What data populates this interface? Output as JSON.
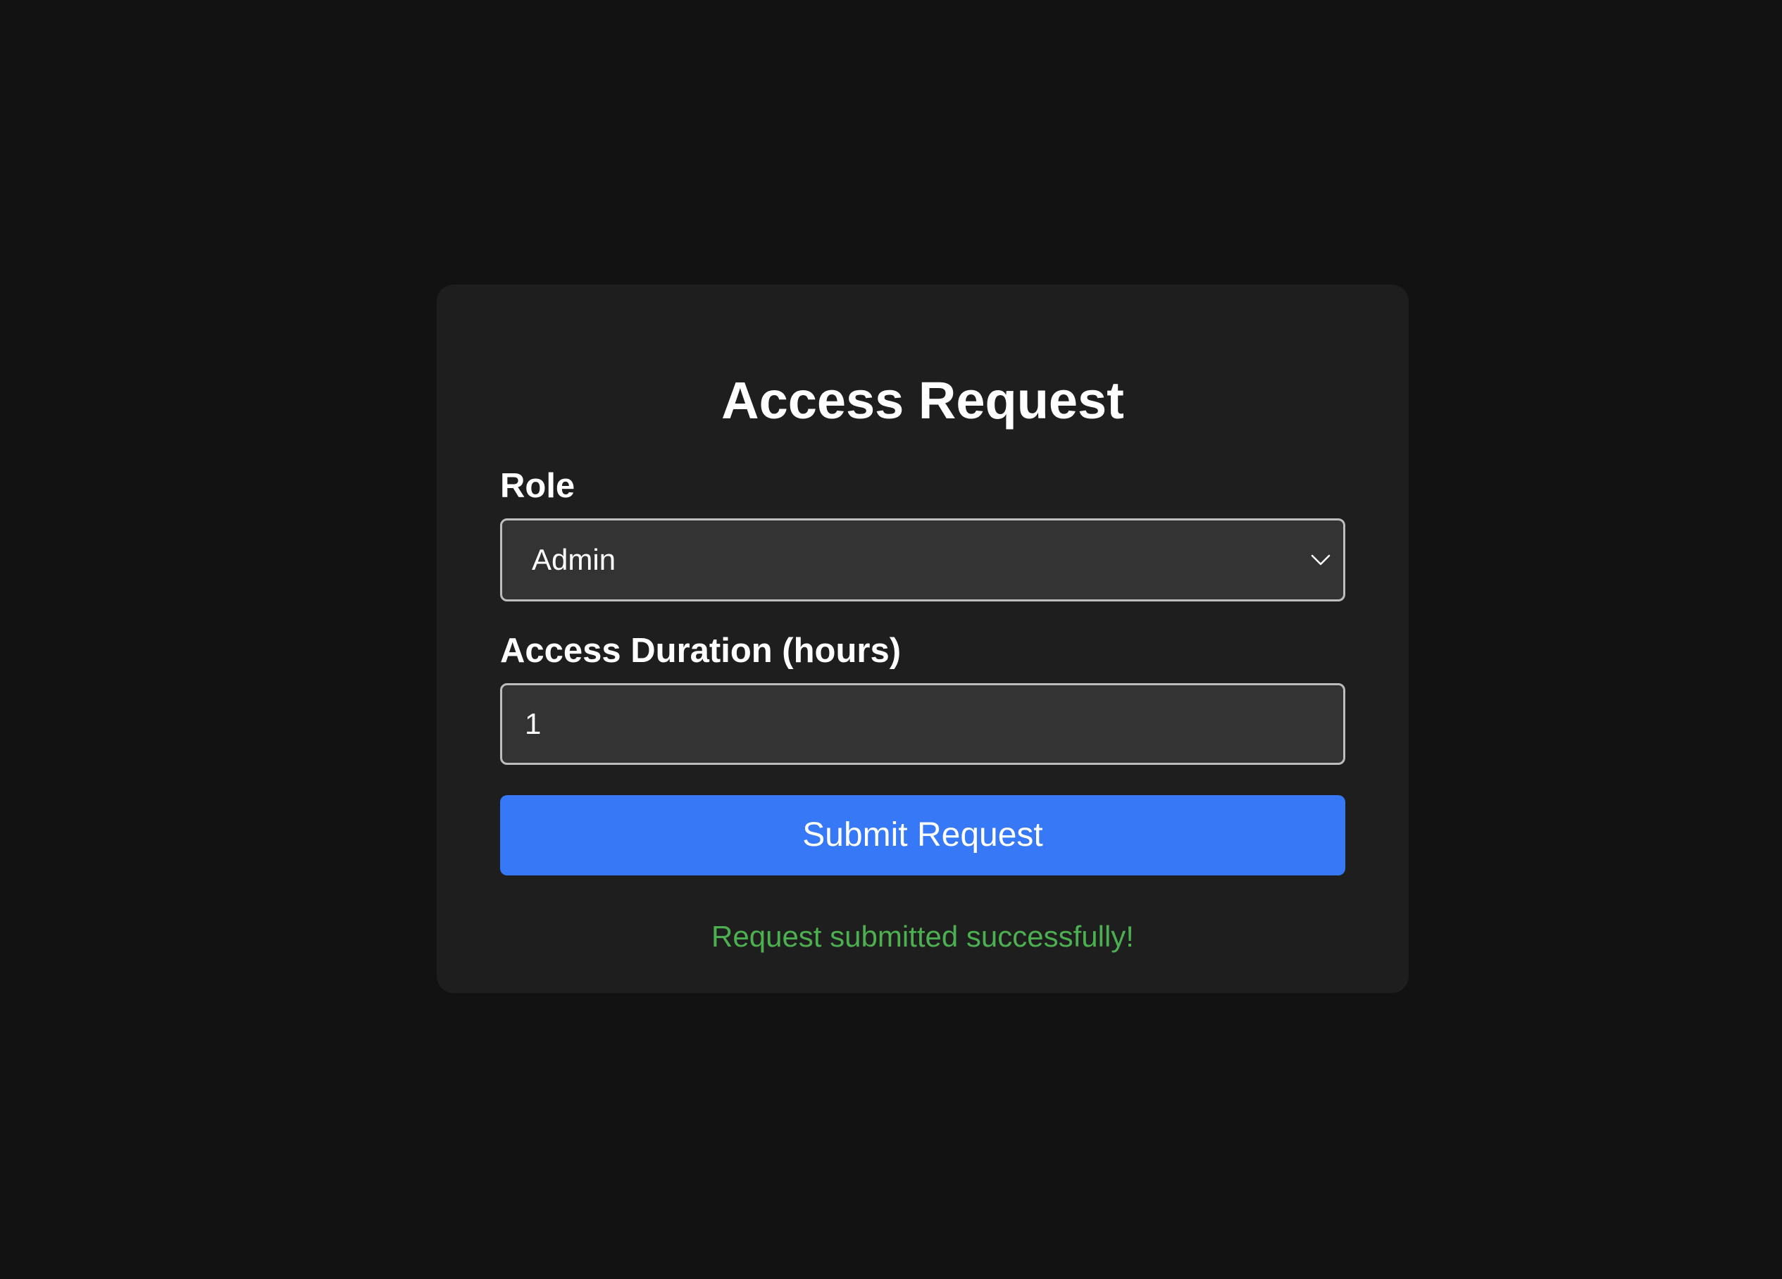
{
  "form": {
    "title": "Access Request",
    "role": {
      "label": "Role",
      "selected_value": "Admin",
      "icon": "chevron-down-icon"
    },
    "duration": {
      "label": "Access Duration (hours)",
      "value": "1"
    },
    "submit_label": "Submit Request",
    "status_message": "Request submitted successfully!"
  },
  "colors": {
    "background": "#121212",
    "card": "#1e1e1e",
    "field_background": "#333333",
    "field_border": "#bdbdbd",
    "accent": "#3678f6",
    "success": "#4caf50"
  }
}
